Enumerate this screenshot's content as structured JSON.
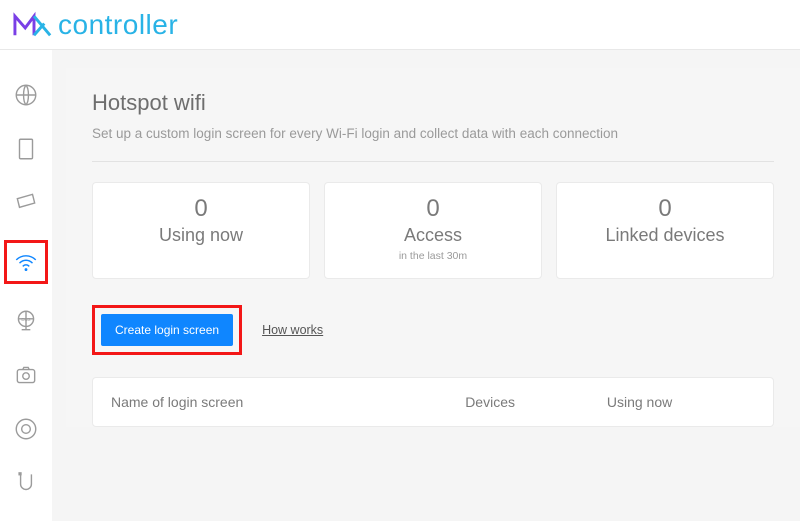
{
  "brand": {
    "name": "controller"
  },
  "sidebar": {
    "items": [
      {
        "name": "globe-icon"
      },
      {
        "name": "file-icon"
      },
      {
        "name": "ticket-icon"
      },
      {
        "name": "wifi-icon"
      },
      {
        "name": "dns-icon"
      },
      {
        "name": "camera-icon"
      },
      {
        "name": "mikrotik-icon"
      },
      {
        "name": "ubiquiti-icon"
      }
    ]
  },
  "page": {
    "title": "Hotspot wifi",
    "subtitle": "Set up a custom login screen for every Wi-Fi login and collect data with each connection"
  },
  "stats": {
    "using_now": {
      "value": "0",
      "label": "Using now"
    },
    "access": {
      "value": "0",
      "label": "Access",
      "sub": "in the last 30m"
    },
    "linked": {
      "value": "0",
      "label": "Linked devices"
    }
  },
  "actions": {
    "create_label": "Create login screen",
    "how_works_label": "How works"
  },
  "table": {
    "col_name": "Name of login screen",
    "col_devices": "Devices",
    "col_using": "Using now"
  }
}
